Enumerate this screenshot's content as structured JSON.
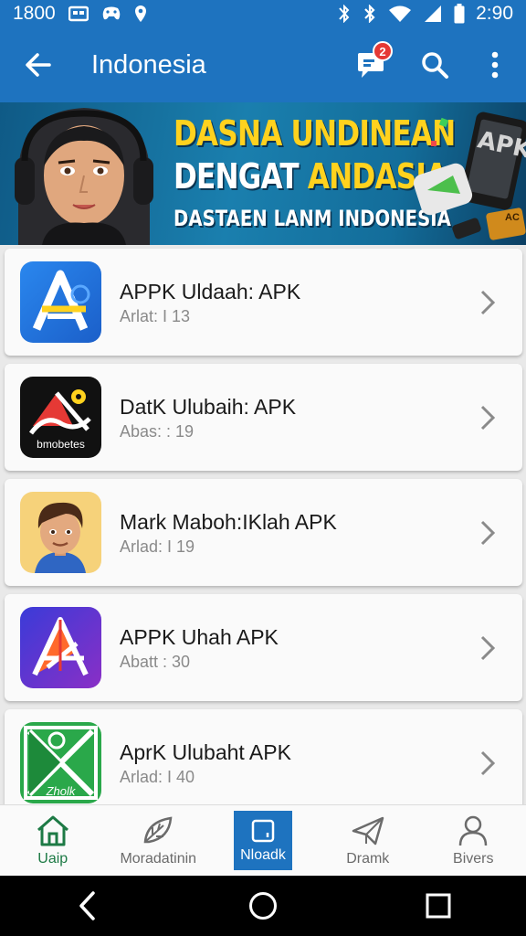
{
  "status_bar": {
    "left_text": "1800",
    "time": "2:90",
    "icons": [
      "notification-icon",
      "gamepad-icon",
      "location-icon",
      "nfc-icon",
      "bluetooth-icon",
      "wifi-icon",
      "signal-icon",
      "battery-icon"
    ]
  },
  "app_bar": {
    "title": "Indonesia",
    "message_badge": "2",
    "icons": [
      "back-arrow-icon",
      "message-icon",
      "search-icon",
      "more-vert-icon"
    ]
  },
  "banner": {
    "line1": "DASNA UNDINEAN",
    "line2_white": "DENGAT ",
    "line2_yellow": "ANDASIA",
    "line3": "DASTAEN LANM INDONESIA",
    "phone_label": "APK",
    "chip_label": "AC"
  },
  "apps": [
    {
      "title": "APPK Uldaah: APK",
      "subtitle": "Arlat: I 13",
      "icon": "blue-a-app-icon",
      "colors": [
        "#2a7fe8",
        "#1b5fc9"
      ]
    },
    {
      "title": "DatK Ulubaih: APK",
      "subtitle": "Abas: : 19",
      "icon": "black-a-app-icon",
      "icon_caption": "bmobetes",
      "colors": [
        "#111111"
      ]
    },
    {
      "title": "Mark Maboh:IKlah APK",
      "subtitle": "Arlad: I 19",
      "icon": "avatar-app-icon",
      "colors": [
        "#f6d27a"
      ]
    },
    {
      "title": "APPK Uhah APK",
      "subtitle": "Abatt : 30",
      "icon": "purple-a-app-icon",
      "colors": [
        "#4a35d6",
        "#7a32c9"
      ]
    },
    {
      "title": "AprK Ulubaht APK",
      "subtitle": "Arlad: I 40",
      "icon": "green-x-app-icon",
      "icon_caption": "Zholk",
      "colors": [
        "#2aa84a"
      ]
    }
  ],
  "bottom_nav": {
    "items": [
      {
        "label": "Uaip",
        "icon": "home-icon"
      },
      {
        "label": "Moradatinin",
        "icon": "leaf-icon"
      },
      {
        "label": "Nloadk",
        "icon": "download-icon"
      },
      {
        "label": "Dramk",
        "icon": "send-icon"
      },
      {
        "label": "Bivers",
        "icon": "person-icon"
      }
    ]
  },
  "system_nav": {
    "icons": [
      "back-icon",
      "home-circle-icon",
      "recents-icon"
    ]
  },
  "colors": {
    "primary": "#1e73bf",
    "accent_yellow": "#ffd21e",
    "badge_red": "#e53935",
    "nav_green": "#1d7a45"
  }
}
